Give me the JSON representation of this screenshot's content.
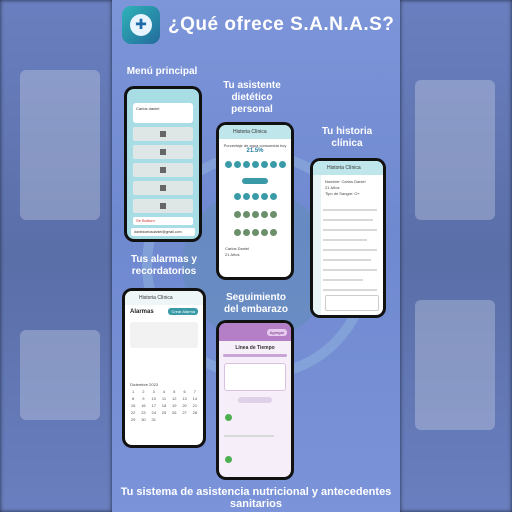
{
  "title": "¿Qué ofrece S.A.N.A.S?",
  "footer": "Tu sistema de asistencia nutricional y antecedentes sanitarios",
  "features": {
    "menu": "Menú principal",
    "dietetic": "Tu asistente dietético personal",
    "history": "Tu historia clínica",
    "alarms": "Tus alarmas y recordatorios",
    "pregnancy": "Seguimiento del embarazo"
  },
  "phones": {
    "menu": {
      "label": "Carlos daniel",
      "button": "Se Bottom",
      "email": "danielcarlosdaniel@gmail.com"
    },
    "diet": {
      "header": "Historia Clínica",
      "water_title": "Porcentaje de agua consumida hoy",
      "water_pct": "21.5%",
      "name": "Carlos Daniel",
      "age": "21 Años"
    },
    "history": {
      "header": "Historia Clínica",
      "name": "Nombre: Carlos Daniel",
      "age": "21 Años",
      "blood": "Tipo de Sangre: O+"
    },
    "alarms": {
      "header": "Historia Clínica",
      "title": "Alarmas",
      "add": "Crear Alarma",
      "month": "Diciembre 2023"
    },
    "pregnancy": {
      "title": "Línea de Tiempo",
      "add": "Agregar"
    }
  },
  "colors": {
    "accent": "#6f89d0",
    "teal": "#3a9aa8",
    "purple": "#b47fc7"
  }
}
